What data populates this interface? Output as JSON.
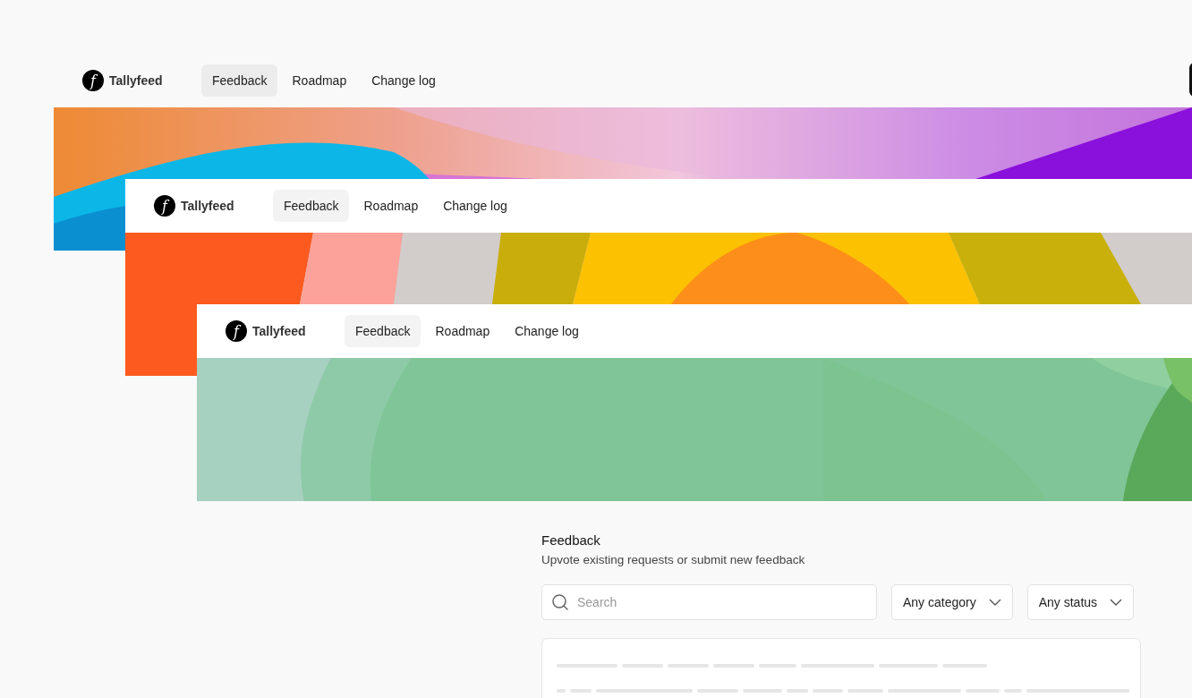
{
  "cards": [
    {
      "logo_mark": "f",
      "brand": "Tallyfeed",
      "nav": [
        {
          "label": "Feedback",
          "selected": true
        },
        {
          "label": "Roadmap",
          "selected": false
        },
        {
          "label": "Change log",
          "selected": false
        }
      ]
    },
    {
      "logo_mark": "f",
      "brand": "Tallyfeed",
      "nav": [
        {
          "label": "Feedback",
          "selected": true
        },
        {
          "label": "Roadmap",
          "selected": false
        },
        {
          "label": "Change log",
          "selected": false
        }
      ]
    },
    {
      "logo_mark": "f",
      "brand": "Tallyfeed",
      "nav": [
        {
          "label": "Feedback",
          "selected": true
        },
        {
          "label": "Roadmap",
          "selected": false
        },
        {
          "label": "Change log",
          "selected": false
        }
      ]
    }
  ],
  "feedback": {
    "title": "Feedback",
    "subtitle": "Upvote existing requests or submit new feedback",
    "search": {
      "placeholder": "Search"
    },
    "filters": [
      "Any category",
      "Any status"
    ]
  }
}
